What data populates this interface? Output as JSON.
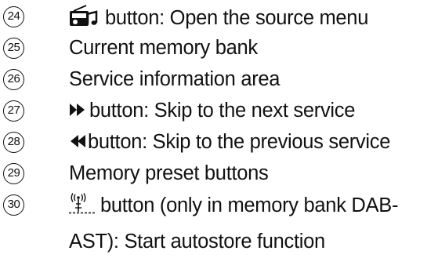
{
  "items": [
    {
      "number": "24",
      "icon": "source-radio-music-icon",
      "text": "button: Open the source menu"
    },
    {
      "number": "25",
      "text": "Current memory bank"
    },
    {
      "number": "26",
      "text": "Service information area"
    },
    {
      "number": "27",
      "icon": "skip-forward-icon",
      "text": "button: Skip to the next service"
    },
    {
      "number": "28",
      "icon": "skip-back-icon",
      "text": "button: Skip to the previous service"
    },
    {
      "number": "29",
      "text": "Memory preset buttons"
    },
    {
      "number": "30",
      "icon": "autostore-antenna-icon",
      "text": "button (only in memory bank DAB-",
      "continuation": "AST): Start autostore function"
    }
  ]
}
